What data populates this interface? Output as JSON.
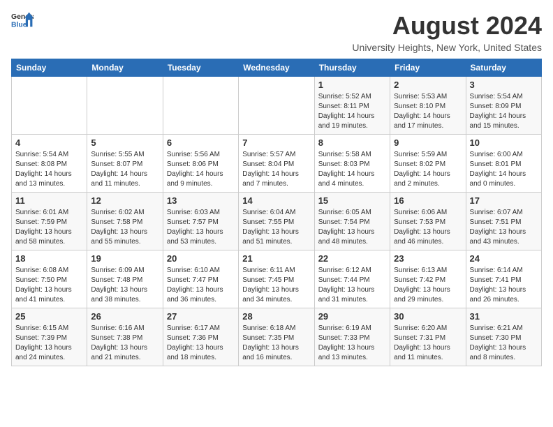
{
  "header": {
    "logo_line1": "General",
    "logo_line2": "Blue",
    "month_year": "August 2024",
    "location": "University Heights, New York, United States"
  },
  "days_of_week": [
    "Sunday",
    "Monday",
    "Tuesday",
    "Wednesday",
    "Thursday",
    "Friday",
    "Saturday"
  ],
  "weeks": [
    [
      {
        "day": "",
        "info": ""
      },
      {
        "day": "",
        "info": ""
      },
      {
        "day": "",
        "info": ""
      },
      {
        "day": "",
        "info": ""
      },
      {
        "day": "1",
        "info": "Sunrise: 5:52 AM\nSunset: 8:11 PM\nDaylight: 14 hours\nand 19 minutes."
      },
      {
        "day": "2",
        "info": "Sunrise: 5:53 AM\nSunset: 8:10 PM\nDaylight: 14 hours\nand 17 minutes."
      },
      {
        "day": "3",
        "info": "Sunrise: 5:54 AM\nSunset: 8:09 PM\nDaylight: 14 hours\nand 15 minutes."
      }
    ],
    [
      {
        "day": "4",
        "info": "Sunrise: 5:54 AM\nSunset: 8:08 PM\nDaylight: 14 hours\nand 13 minutes."
      },
      {
        "day": "5",
        "info": "Sunrise: 5:55 AM\nSunset: 8:07 PM\nDaylight: 14 hours\nand 11 minutes."
      },
      {
        "day": "6",
        "info": "Sunrise: 5:56 AM\nSunset: 8:06 PM\nDaylight: 14 hours\nand 9 minutes."
      },
      {
        "day": "7",
        "info": "Sunrise: 5:57 AM\nSunset: 8:04 PM\nDaylight: 14 hours\nand 7 minutes."
      },
      {
        "day": "8",
        "info": "Sunrise: 5:58 AM\nSunset: 8:03 PM\nDaylight: 14 hours\nand 4 minutes."
      },
      {
        "day": "9",
        "info": "Sunrise: 5:59 AM\nSunset: 8:02 PM\nDaylight: 14 hours\nand 2 minutes."
      },
      {
        "day": "10",
        "info": "Sunrise: 6:00 AM\nSunset: 8:01 PM\nDaylight: 14 hours\nand 0 minutes."
      }
    ],
    [
      {
        "day": "11",
        "info": "Sunrise: 6:01 AM\nSunset: 7:59 PM\nDaylight: 13 hours\nand 58 minutes."
      },
      {
        "day": "12",
        "info": "Sunrise: 6:02 AM\nSunset: 7:58 PM\nDaylight: 13 hours\nand 55 minutes."
      },
      {
        "day": "13",
        "info": "Sunrise: 6:03 AM\nSunset: 7:57 PM\nDaylight: 13 hours\nand 53 minutes."
      },
      {
        "day": "14",
        "info": "Sunrise: 6:04 AM\nSunset: 7:55 PM\nDaylight: 13 hours\nand 51 minutes."
      },
      {
        "day": "15",
        "info": "Sunrise: 6:05 AM\nSunset: 7:54 PM\nDaylight: 13 hours\nand 48 minutes."
      },
      {
        "day": "16",
        "info": "Sunrise: 6:06 AM\nSunset: 7:53 PM\nDaylight: 13 hours\nand 46 minutes."
      },
      {
        "day": "17",
        "info": "Sunrise: 6:07 AM\nSunset: 7:51 PM\nDaylight: 13 hours\nand 43 minutes."
      }
    ],
    [
      {
        "day": "18",
        "info": "Sunrise: 6:08 AM\nSunset: 7:50 PM\nDaylight: 13 hours\nand 41 minutes."
      },
      {
        "day": "19",
        "info": "Sunrise: 6:09 AM\nSunset: 7:48 PM\nDaylight: 13 hours\nand 38 minutes."
      },
      {
        "day": "20",
        "info": "Sunrise: 6:10 AM\nSunset: 7:47 PM\nDaylight: 13 hours\nand 36 minutes."
      },
      {
        "day": "21",
        "info": "Sunrise: 6:11 AM\nSunset: 7:45 PM\nDaylight: 13 hours\nand 34 minutes."
      },
      {
        "day": "22",
        "info": "Sunrise: 6:12 AM\nSunset: 7:44 PM\nDaylight: 13 hours\nand 31 minutes."
      },
      {
        "day": "23",
        "info": "Sunrise: 6:13 AM\nSunset: 7:42 PM\nDaylight: 13 hours\nand 29 minutes."
      },
      {
        "day": "24",
        "info": "Sunrise: 6:14 AM\nSunset: 7:41 PM\nDaylight: 13 hours\nand 26 minutes."
      }
    ],
    [
      {
        "day": "25",
        "info": "Sunrise: 6:15 AM\nSunset: 7:39 PM\nDaylight: 13 hours\nand 24 minutes."
      },
      {
        "day": "26",
        "info": "Sunrise: 6:16 AM\nSunset: 7:38 PM\nDaylight: 13 hours\nand 21 minutes."
      },
      {
        "day": "27",
        "info": "Sunrise: 6:17 AM\nSunset: 7:36 PM\nDaylight: 13 hours\nand 18 minutes."
      },
      {
        "day": "28",
        "info": "Sunrise: 6:18 AM\nSunset: 7:35 PM\nDaylight: 13 hours\nand 16 minutes."
      },
      {
        "day": "29",
        "info": "Sunrise: 6:19 AM\nSunset: 7:33 PM\nDaylight: 13 hours\nand 13 minutes."
      },
      {
        "day": "30",
        "info": "Sunrise: 6:20 AM\nSunset: 7:31 PM\nDaylight: 13 hours\nand 11 minutes."
      },
      {
        "day": "31",
        "info": "Sunrise: 6:21 AM\nSunset: 7:30 PM\nDaylight: 13 hours\nand 8 minutes."
      }
    ]
  ]
}
